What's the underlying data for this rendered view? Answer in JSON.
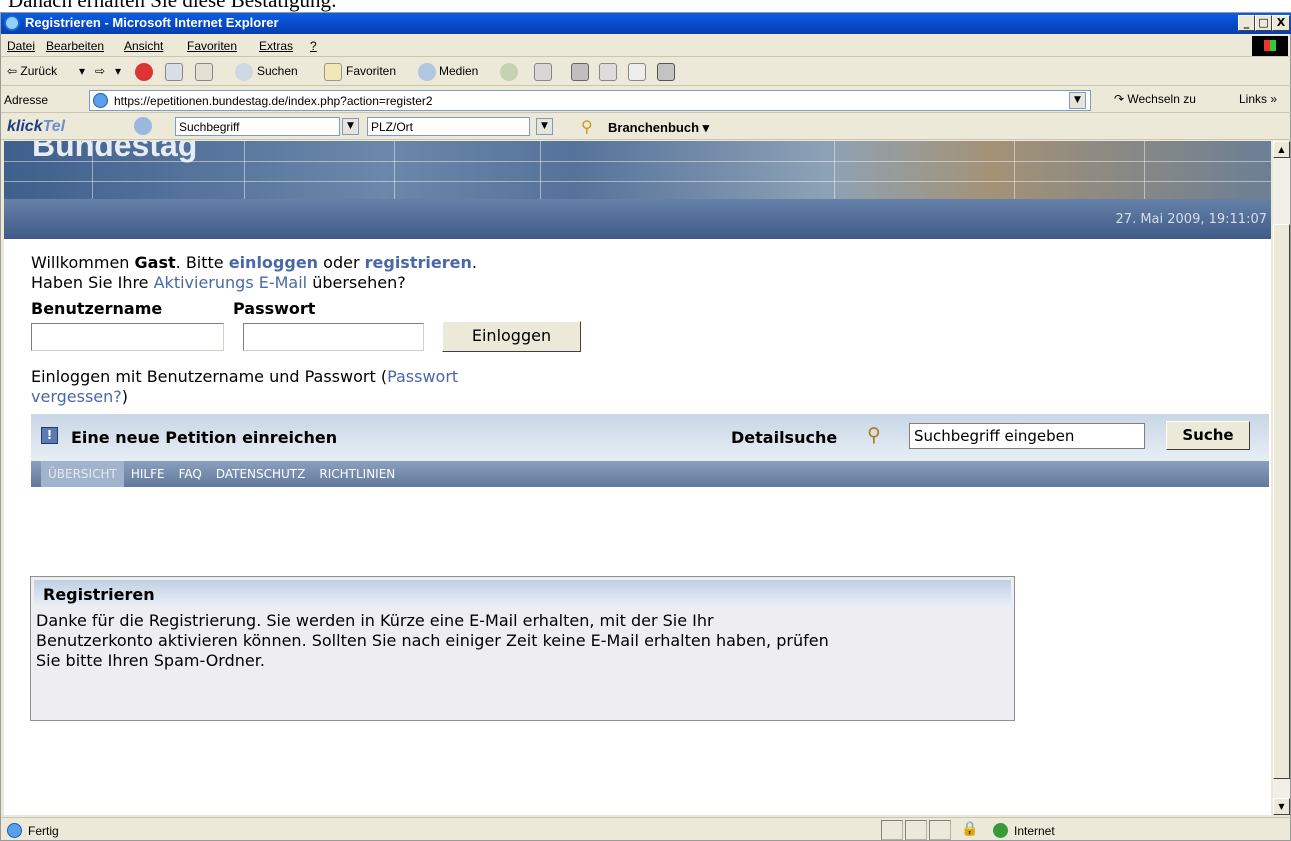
{
  "doc_caption": "Danach erhalten Sie diese Bestätigung:",
  "window": {
    "title": "Registrieren - Microsoft Internet Explorer",
    "controls": [
      "_",
      "□",
      "X"
    ]
  },
  "menu": {
    "items": [
      "Datei",
      "Bearbeiten",
      "Ansicht",
      "Favoriten",
      "Extras",
      "?"
    ]
  },
  "toolbar": {
    "back_label": "⇦ Zurück",
    "search_label": "Suchen",
    "favorites_label": "Favoriten",
    "media_label": "Medien"
  },
  "address": {
    "label": "Adresse",
    "url": "https://epetitionen.bundestag.de/index.php?action=register2",
    "go_label": "Wechseln zu",
    "links_label": "Links »"
  },
  "klicktel": {
    "logo_main": "klick",
    "logo_accent": "Tel",
    "search_placeholder": "Suchbegriff",
    "location_placeholder": "PLZ/Ort",
    "branch_label": "Branchenbuch ▾"
  },
  "page": {
    "banner_text": "Bundestag",
    "datetime": "27. Mai 2009, 19:11:07",
    "welcome": {
      "prefix": "Willkommen ",
      "user": "Gast",
      "mid": ". Bitte ",
      "login_link": "einloggen",
      "or": " oder ",
      "register_link": "registrieren",
      "end": ".",
      "line2_prefix": "Haben Sie Ihre ",
      "activation_link": "Aktivierungs E-Mail",
      "line2_suffix": " übersehen?"
    },
    "login": {
      "username_label": "Benutzername",
      "password_label": "Passwort",
      "username_value": "",
      "password_value": "",
      "button": "Einloggen",
      "hint_prefix": "Einloggen mit Benutzername und Passwort (",
      "forgot_link_1": "Passwort",
      "forgot_link_2": "vergessen?",
      "hint_suffix": ")"
    },
    "petition_bar": {
      "new_petition": "Eine neue Petition einreichen",
      "detail_search": "Detailsuche",
      "search_value": "Suchbegriff eingeben",
      "search_button": "Suche"
    },
    "nav_tabs": [
      "ÜBERSICHT",
      "HILFE",
      "FAQ",
      "DATENSCHUTZ",
      "RICHTLINIEN"
    ],
    "register_box": {
      "heading": "Registrieren",
      "line1": "Danke für die Registrierung. Sie werden in Kürze eine E-Mail erhalten, mit der Sie Ihr",
      "line2": "Benutzerkonto aktivieren können. Sollten Sie nach einiger Zeit keine E-Mail erhalten haben, prüfen",
      "line3": "Sie bitte Ihren Spam-Ordner."
    }
  },
  "status": {
    "text": "Fertig",
    "zone": "Internet"
  },
  "colors": {
    "titlebar": "#0749c7",
    "link": "#4a68a8",
    "header_blue": "#3f5c88"
  }
}
